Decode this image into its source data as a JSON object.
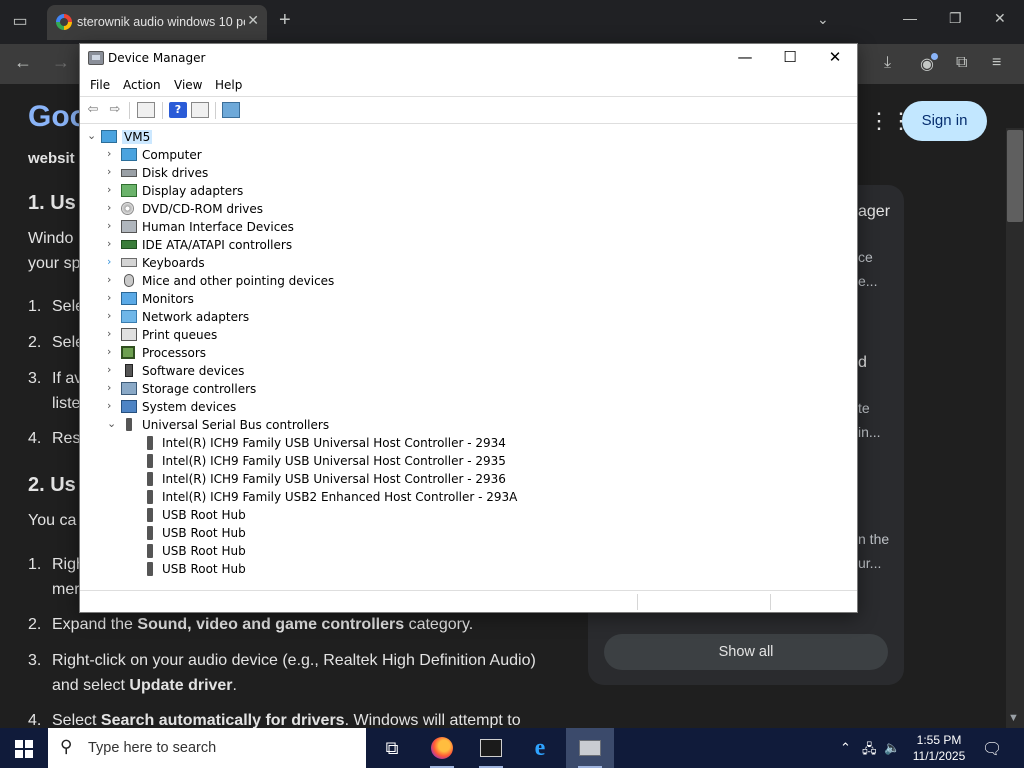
{
  "browser": {
    "tab_title": "sterownik audio windows 10 po",
    "close_glyph": "✕",
    "new_tab_glyph": "+",
    "tab_menu_glyph": "⌄",
    "minimize_glyph": "—",
    "restore_glyph": "❐",
    "close_window_glyph": "✕",
    "back_glyph": "←",
    "forward_glyph": "→",
    "download_glyph": "⤓",
    "profile_glyph": "◉",
    "extensions_glyph": "⧉",
    "menu_glyph": "≡"
  },
  "page": {
    "logo_partial": "Goo",
    "apps_glyph": "⋮⋮⋮",
    "sign_in_label": "Sign in",
    "article": {
      "line_website": "websit",
      "heading_1": "1. Us",
      "intro_1": "Windo",
      "intro_2": "your sp",
      "item_1": "Sele",
      "item_2": "Sele",
      "item_3a": "If av",
      "item_3b": "liste",
      "item_4": "Res",
      "heading_2": "2. Us",
      "you_can": "You ca",
      "step_1a": "Righ",
      "step_1b": "mer",
      "step_2_pre": "Expand the ",
      "step_2_bold": "Sound, video and game controllers",
      "step_2_post": " category.",
      "step_3_pre": "Right-click on your audio device (e.g., Realtek High Definition Audio)",
      "step_3_line2_pre": "and select ",
      "step_3_bold": "Update driver",
      "step_3_post": ".",
      "step_4_pre": "Select ",
      "step_4_bold": "Search automatically for drivers",
      "step_4_post": ". Windows will attempt to",
      "num_1": "1.",
      "num_2": "2.",
      "num_3": "3.",
      "num_4": "4."
    },
    "side": {
      "s1": "ager",
      "s2": "ce",
      "s3": "e...",
      "s4": "d",
      "s5": "te",
      "s6": "in...",
      "s7": "n the",
      "s8": "ur...",
      "show_all": "Show all"
    }
  },
  "device_manager": {
    "title": "Device Manager",
    "menu": [
      "File",
      "Action",
      "View",
      "Help"
    ],
    "toolbar_back": "⇦",
    "toolbar_forward": "⇨",
    "toolbar_help": "?",
    "root": "VM5",
    "categories": [
      "Computer",
      "Disk drives",
      "Display adapters",
      "DVD/CD-ROM drives",
      "Human Interface Devices",
      "IDE ATA/ATAPI controllers",
      "Keyboards",
      "Mice and other pointing devices",
      "Monitors",
      "Network adapters",
      "Print queues",
      "Processors",
      "Software devices",
      "Storage controllers",
      "System devices",
      "Universal Serial Bus controllers"
    ],
    "usb_devices": [
      "Intel(R) ICH9 Family USB Universal Host Controller - 2934",
      "Intel(R) ICH9 Family USB Universal Host Controller - 2935",
      "Intel(R) ICH9 Family USB Universal Host Controller - 2936",
      "Intel(R) ICH9 Family USB2 Enhanced Host Controller - 293A",
      "USB Root Hub",
      "USB Root Hub",
      "USB Root Hub",
      "USB Root Hub"
    ],
    "chevron_collapsed": "›",
    "chevron_expanded": "⌄"
  },
  "taskbar": {
    "search_placeholder": "Type here to search",
    "search_glyph": "⚲",
    "time": "1:55 PM",
    "date": "11/1/2025",
    "apps": [
      "task-view",
      "firefox",
      "terminal",
      "internet-explorer",
      "device-manager"
    ],
    "tray_chevron": "⌃",
    "tray_network": "🖧",
    "tray_volume": "🔈",
    "notification_glyph": "🗨"
  }
}
